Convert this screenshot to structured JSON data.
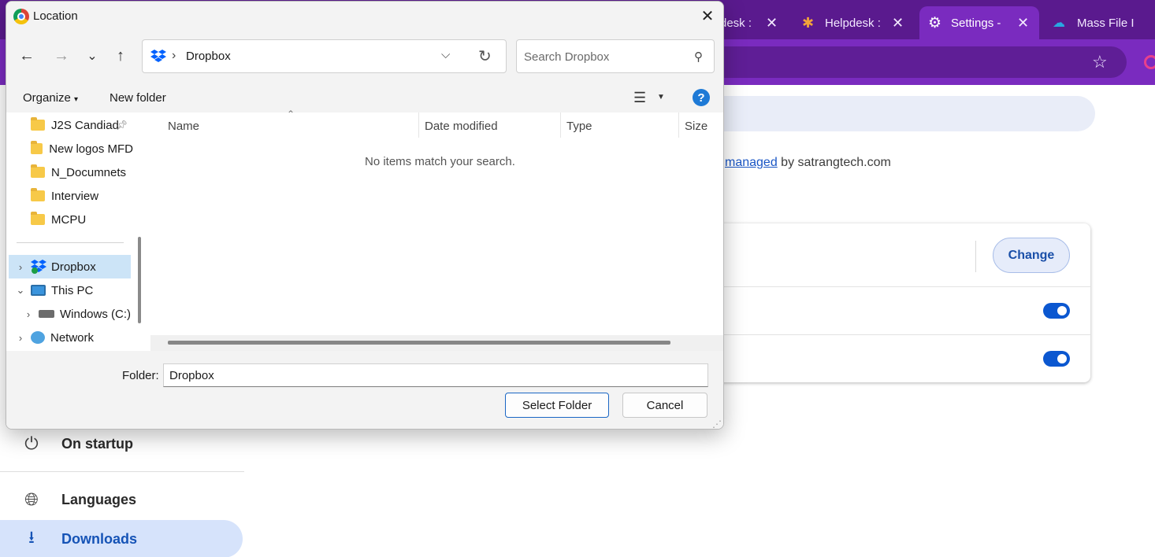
{
  "browser": {
    "tabs": [
      {
        "title": "desk :",
        "active": false
      },
      {
        "title": "Helpdesk :",
        "active": false
      },
      {
        "title": "Settings - ",
        "active": true
      },
      {
        "title": "Mass File I",
        "active": false
      }
    ],
    "close_glyph": "✕",
    "accent_color": "#5a1a8e"
  },
  "settings": {
    "managed_link": "managed",
    "managed_suffix": " by satrangtech.com",
    "change_label": "Change",
    "nav": [
      {
        "label": "On startup",
        "icon": "power-icon"
      },
      {
        "label": "Languages",
        "icon": "globe-icon"
      },
      {
        "label": "Downloads",
        "icon": "download-icon",
        "selected": true
      }
    ]
  },
  "dialog": {
    "title": "Location",
    "address": "Dropbox",
    "search_placeholder": "Search Dropbox",
    "organize_label": "Organize",
    "new_folder_label": "New folder",
    "help_glyph": "?",
    "tree": [
      {
        "label": "J2S Candiad",
        "type": "folder",
        "pinned": true
      },
      {
        "label": "New logos MFD",
        "type": "folder"
      },
      {
        "label": "N_Documnets",
        "type": "folder"
      },
      {
        "label": "Interview",
        "type": "folder"
      },
      {
        "label": "MCPU",
        "type": "folder"
      },
      {
        "label": "Dropbox",
        "type": "dropbox",
        "selected": true
      },
      {
        "label": "This PC",
        "type": "pc",
        "expanded": true
      },
      {
        "label": "Windows (C:)",
        "type": "drive"
      },
      {
        "label": "Network",
        "type": "network"
      }
    ],
    "columns": [
      "Name",
      "Date modified",
      "Type",
      "Size"
    ],
    "empty_message": "No items match your search.",
    "folder_label": "Folder:",
    "folder_value": "Dropbox",
    "select_button": "Select Folder",
    "cancel_button": "Cancel"
  }
}
